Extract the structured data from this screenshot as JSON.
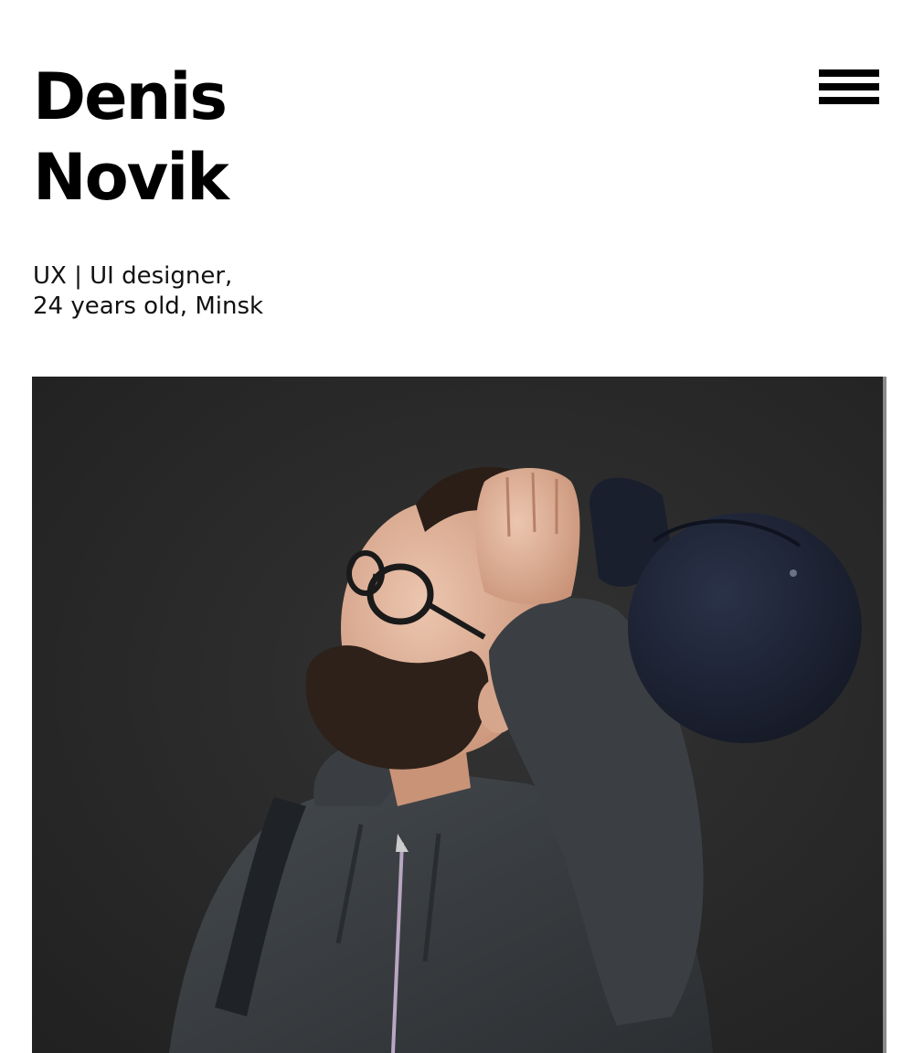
{
  "header": {
    "name_line1": "Denis",
    "name_line2": "Novik",
    "menu_icon": "hamburger-menu-icon"
  },
  "intro": {
    "line1": "UX | UI designer,",
    "line2": "24 years old, Minsk"
  },
  "photo": {
    "subject": "portrait-photo",
    "colors": {
      "wall": "#2a2a2a",
      "hoodie": "#3a3d40",
      "cap": "#1c2233",
      "skin": "#e2b59d",
      "hair": "#2a1e17"
    }
  }
}
